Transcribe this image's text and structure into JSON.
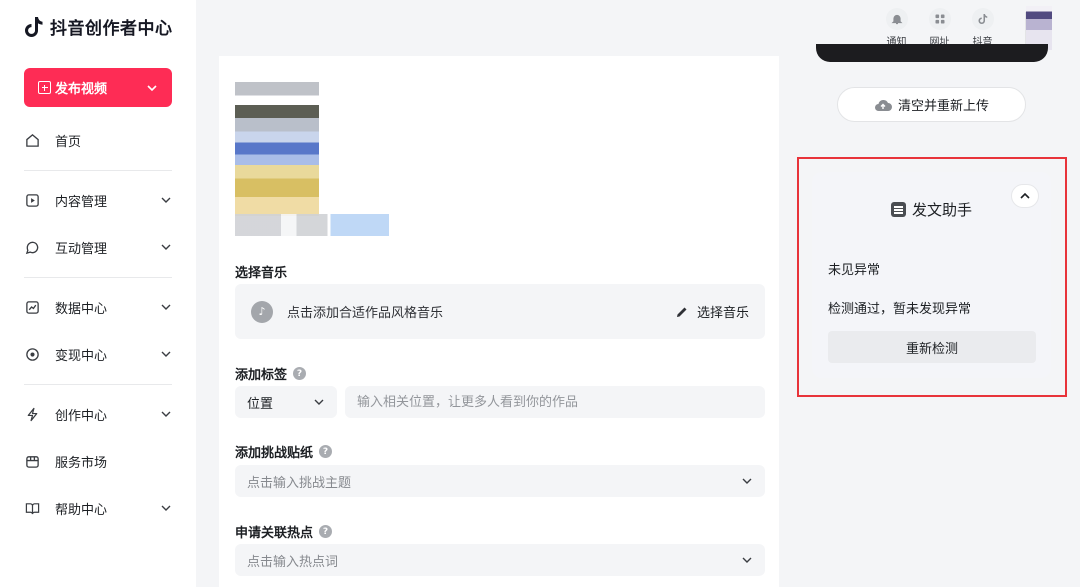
{
  "app": {
    "title": "抖音创作者中心"
  },
  "sidebar": {
    "publish_label": "发布视频",
    "items": [
      {
        "label": "首页",
        "icon": "home-icon",
        "expandable": false
      },
      {
        "label": "内容管理",
        "icon": "content-icon",
        "expandable": true
      },
      {
        "label": "互动管理",
        "icon": "interaction-icon",
        "expandable": true
      },
      {
        "label": "数据中心",
        "icon": "data-chart-icon",
        "expandable": true
      },
      {
        "label": "变现中心",
        "icon": "monetize-icon",
        "expandable": true
      },
      {
        "label": "创作中心",
        "icon": "lightning-icon",
        "expandable": true
      },
      {
        "label": "服务市场",
        "icon": "market-icon",
        "expandable": false
      },
      {
        "label": "帮助中心",
        "icon": "book-icon",
        "expandable": true
      }
    ]
  },
  "header": {
    "tools": [
      {
        "label": "通知",
        "icon": "bell-icon"
      },
      {
        "label": "网址",
        "icon": "grid-icon"
      },
      {
        "label": "抖音",
        "icon": "douyin-icon"
      }
    ]
  },
  "main": {
    "music": {
      "title": "选择音乐",
      "hint": "点击添加合适作品风格音乐",
      "action": "选择音乐"
    },
    "tags": {
      "title": "添加标签",
      "select_value": "位置",
      "input_placeholder": "输入相关位置，让更多人看到你的作品"
    },
    "challenge": {
      "title": "添加挑战贴纸",
      "placeholder": "点击输入挑战主题"
    },
    "hotspot": {
      "title": "申请关联热点",
      "placeholder": "点击输入热点词"
    }
  },
  "right": {
    "reupload_label": "清空并重新上传",
    "assistant": {
      "title": "发文助手",
      "status_title": "未见异常",
      "status_desc": "检测通过，暂未发现异常",
      "recheck_label": "重新检测"
    }
  },
  "colors": {
    "brand": "#fe2c55",
    "highlight": "#e8333a"
  }
}
